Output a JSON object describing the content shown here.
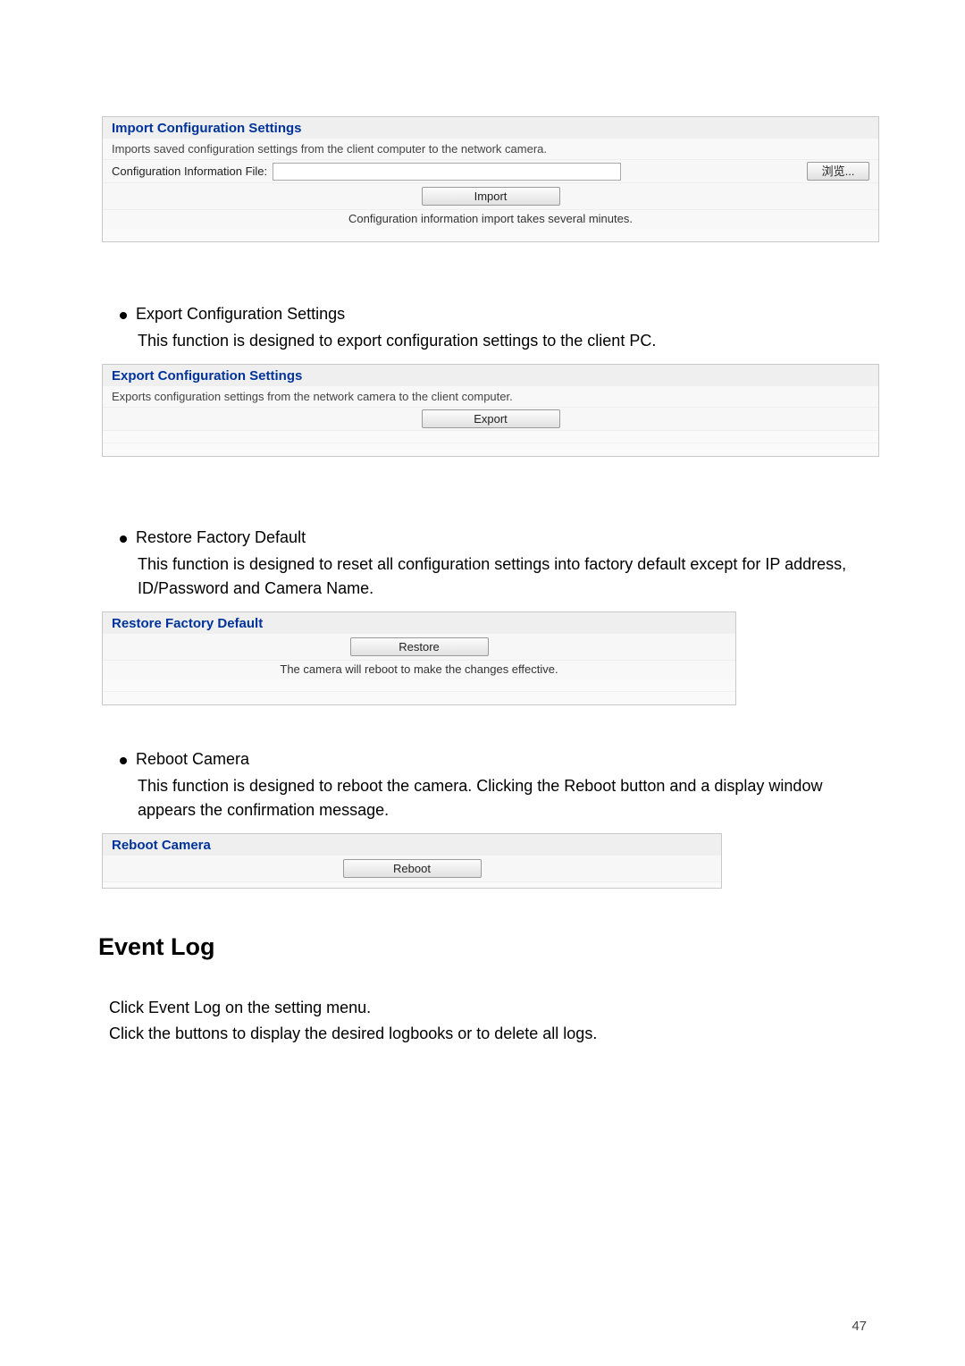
{
  "import_panel": {
    "title": "Import Configuration Settings",
    "desc": "Imports saved configuration settings from the client computer to the network camera.",
    "file_label": "Configuration Information File:",
    "browse_btn": "浏览...",
    "import_btn": "Import",
    "info": "Configuration information import takes several minutes."
  },
  "bullet_export": {
    "title": "Export Configuration Settings",
    "desc": "This function is designed to export configuration settings to the client PC."
  },
  "export_panel": {
    "title": "Export Configuration Settings",
    "desc": "Exports configuration settings from the network camera to the client computer.",
    "export_btn": "Export"
  },
  "bullet_restore": {
    "title": "Restore Factory Default",
    "desc": "This function is designed to reset all configuration settings into factory default except for IP address, ID/Password and Camera Name."
  },
  "restore_panel": {
    "title": "Restore Factory Default",
    "restore_btn": "Restore",
    "info": "The camera will reboot to make the changes effective."
  },
  "bullet_reboot": {
    "title": "Reboot Camera",
    "desc": "This function is designed to reboot the camera. Clicking the Reboot button and a display window appears the confirmation message."
  },
  "reboot_panel": {
    "title": "Reboot Camera",
    "reboot_btn": "Reboot"
  },
  "event_log": {
    "heading": "Event Log",
    "line1": "Click Event Log on the setting menu.",
    "line2": "Click the buttons to display the desired logbooks or to delete all logs."
  },
  "page_number": "47"
}
